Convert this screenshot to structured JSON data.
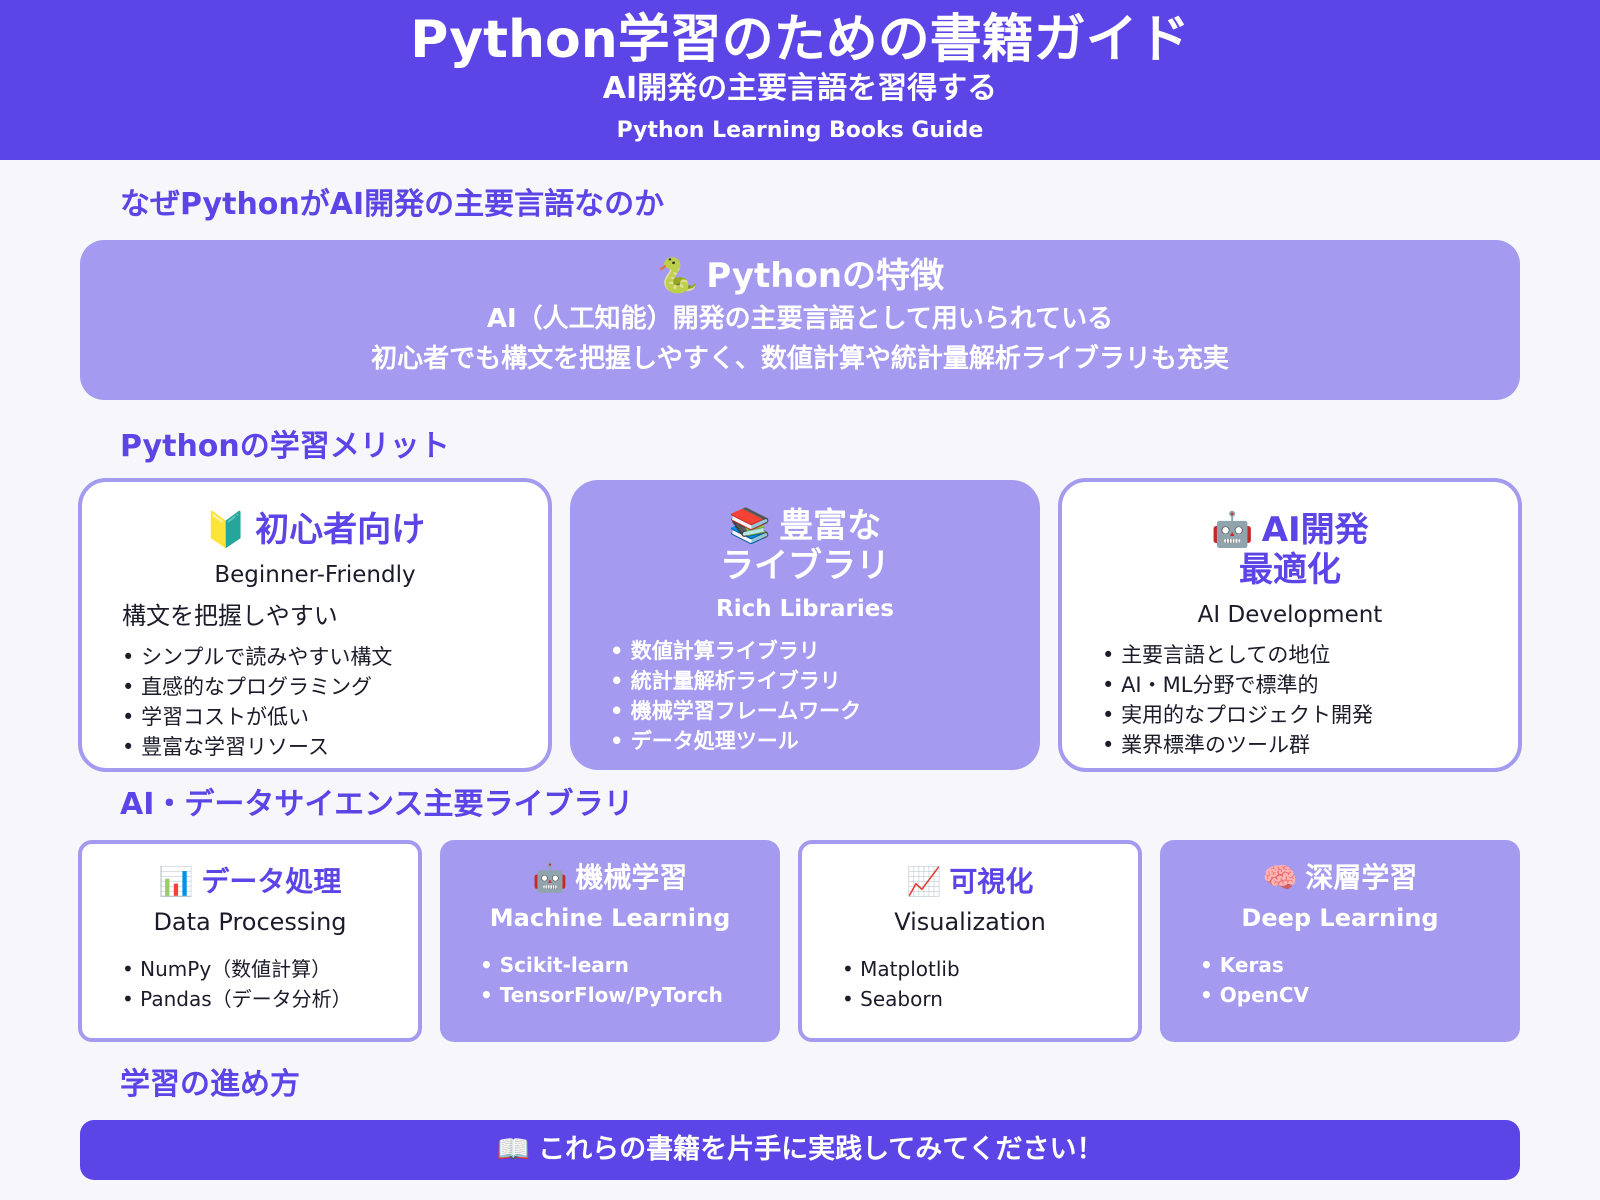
{
  "header": {
    "title": "Python学習のための書籍ガイド",
    "subtitle": "AI開発の主要言語を習得する",
    "english": "Python Learning Books Guide"
  },
  "section_why": {
    "title": "なぜPythonがAI開発の主要言語なのか"
  },
  "features": {
    "icon": "🐍",
    "title": "Pythonの特徴",
    "line1": "AI（人工知能）開発の主要言語として用いられている",
    "line2": "初心者でも構文を把握しやすく、数値計算や統計量解析ライブラリも充実"
  },
  "section_merits": {
    "title": "Pythonの学習メリット"
  },
  "merits": [
    {
      "icon": "🔰",
      "title": "初心者向け",
      "english": "Beginner-Friendly",
      "lead": "構文を把握しやすい",
      "items": [
        "シンプルで読みやすい構文",
        "直感的なプログラミング",
        "学習コストが低い",
        "豊富な学習リソース"
      ]
    },
    {
      "icon": "📚",
      "title_line1": "豊富な",
      "title_line2": "ライブラリ",
      "english": "Rich Libraries",
      "items": [
        "数値計算ライブラリ",
        "統計量解析ライブラリ",
        "機械学習フレームワーク",
        "データ処理ツール"
      ]
    },
    {
      "icon": "🤖",
      "title_line1": "AI開発",
      "title_line2": "最適化",
      "english": "AI Development",
      "items": [
        "主要言語としての地位",
        "AI・ML分野で標準的",
        "実用的なプロジェクト開発",
        "業界標準のツール群"
      ]
    }
  ],
  "section_libs": {
    "title": "AI・データサイエンス主要ライブラリ"
  },
  "libraries": [
    {
      "icon": "📊",
      "title": "データ処理",
      "english": "Data Processing",
      "items": [
        "NumPy（数値計算）",
        "Pandas（データ分析）"
      ]
    },
    {
      "icon": "🤖",
      "title": "機械学習",
      "english": "Machine Learning",
      "items": [
        "Scikit-learn",
        "TensorFlow/PyTorch"
      ]
    },
    {
      "icon": "📈",
      "title": "可視化",
      "english": "Visualization",
      "items": [
        "Matplotlib",
        "Seaborn"
      ]
    },
    {
      "icon": "🧠",
      "title": "深層学習",
      "english": "Deep Learning",
      "items": [
        "Keras",
        "OpenCV"
      ]
    }
  ],
  "section_howto": {
    "title": "学習の進め方"
  },
  "cta": {
    "icon": "📖",
    "text": "これらの書籍を片手に実践してみてください！"
  },
  "colors": {
    "primary": "#5b45e6",
    "light": "#a49bf0",
    "background": "#f7f7fb"
  }
}
